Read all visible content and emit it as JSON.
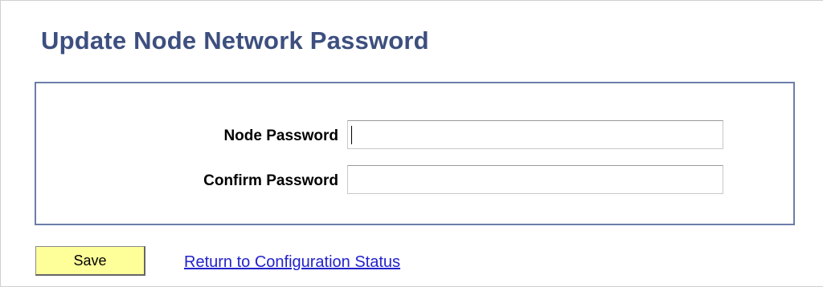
{
  "page": {
    "title": "Update Node Network Password"
  },
  "form": {
    "node_password_label": "Node Password",
    "node_password_value": "",
    "confirm_password_label": "Confirm Password",
    "confirm_password_value": ""
  },
  "actions": {
    "save_label": "Save",
    "return_link_label": "Return to Configuration Status"
  },
  "colors": {
    "title": "#3d4f7f",
    "box_border": "#6b7ea8",
    "save_button_bg": "#ffff99",
    "link": "#2222cc"
  }
}
